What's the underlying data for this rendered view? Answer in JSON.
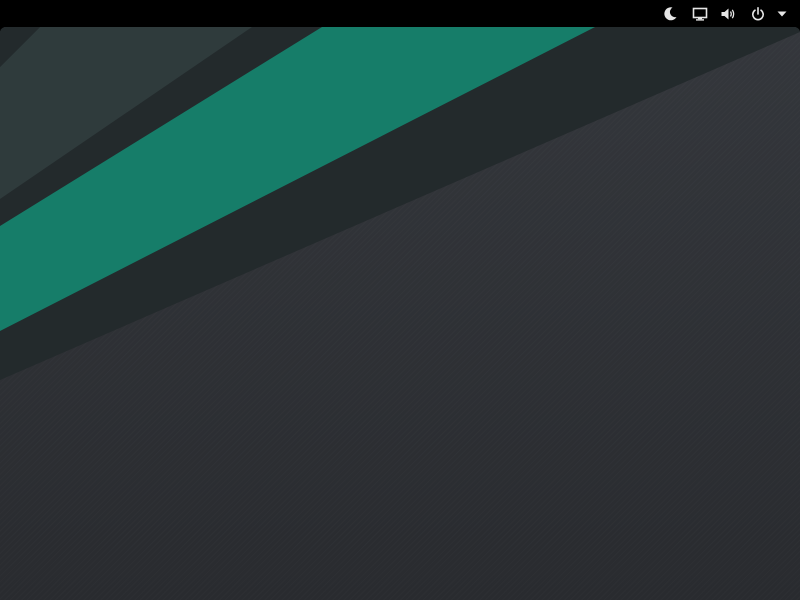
{
  "topbar": {
    "tray_icons": [
      {
        "name": "night-light-icon"
      },
      {
        "name": "display-icon"
      },
      {
        "name": "volume-icon"
      },
      {
        "name": "power-icon"
      },
      {
        "name": "system-menu-arrow-icon"
      }
    ]
  },
  "wallpaper": {
    "colors": {
      "band_light": "#2f3b3c",
      "band_dark": "#232a2c",
      "band_green": "#167d69",
      "background_top": "#33363b",
      "background_bottom": "#292b2f",
      "topbar": "#000000",
      "icon": "#e6e6e6"
    }
  }
}
